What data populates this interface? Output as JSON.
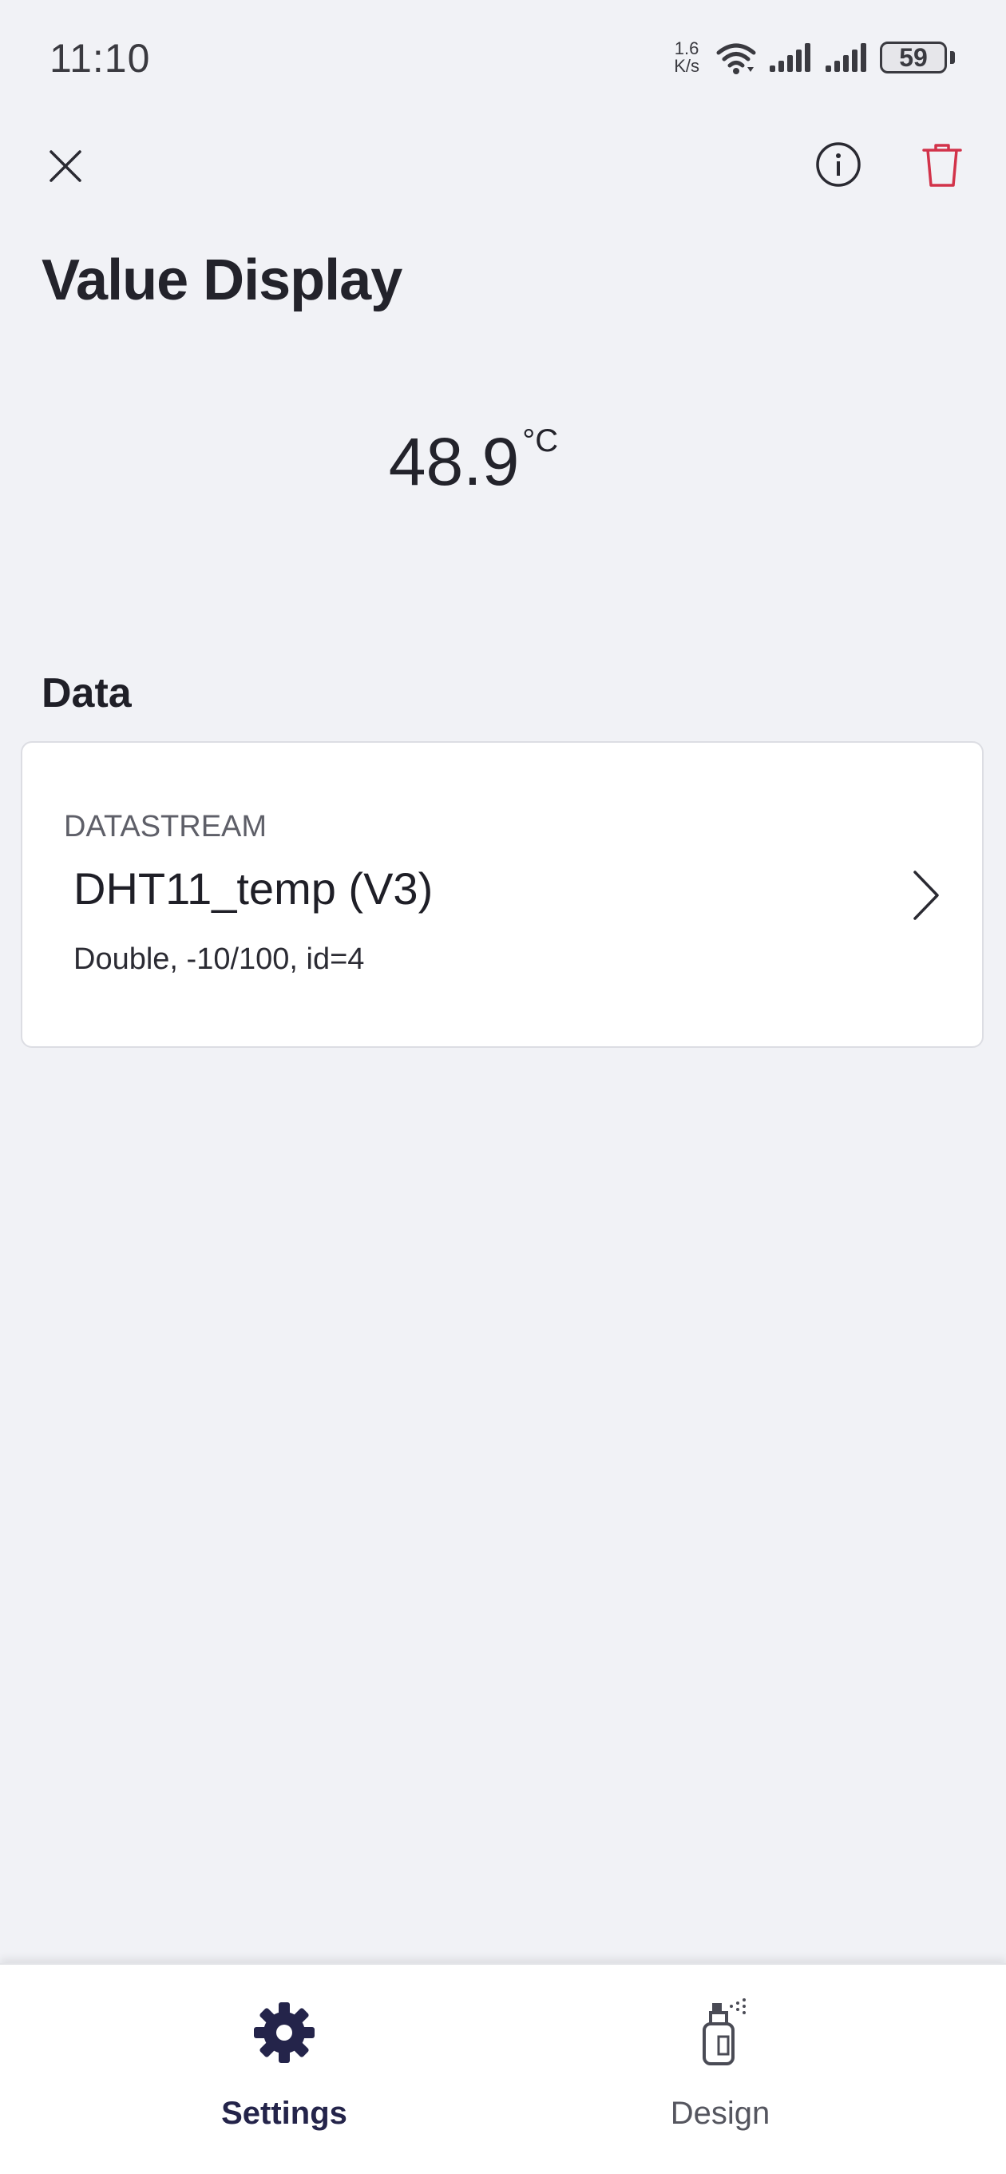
{
  "status_bar": {
    "time": "11:10",
    "net_speed_value": "1.6",
    "net_speed_unit": "K/s",
    "battery": "59",
    "icons": [
      "wifi-icon",
      "signal-icon",
      "signal-icon",
      "battery-icon"
    ]
  },
  "toolbar": {
    "icons": [
      "close-icon",
      "info-icon",
      "trash-icon"
    ],
    "delete_color": "#d2334a"
  },
  "page": {
    "title": "Value Display"
  },
  "preview": {
    "value": "48.9",
    "unit": "°C"
  },
  "data_section": {
    "label": "Data",
    "datastream": {
      "caption": "DATASTREAM",
      "name": "DHT11_temp (V3)",
      "meta": "Double, -10/100, id=4"
    }
  },
  "bottom_nav": {
    "tabs": [
      {
        "label": "Settings",
        "icon": "gear-icon",
        "active": true
      },
      {
        "label": "Design",
        "icon": "spray-can-icon",
        "active": false
      }
    ],
    "active_color": "#24244a"
  }
}
